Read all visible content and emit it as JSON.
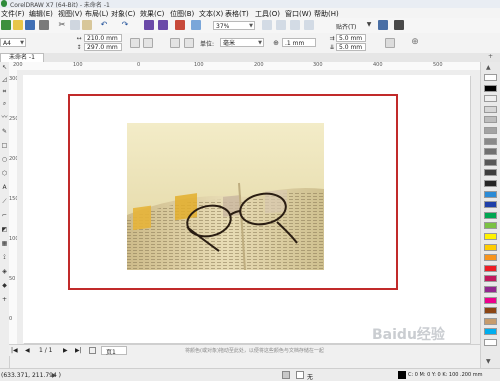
{
  "window": {
    "title": "CorelDRAW X7 (64-Bit) - 未命名 -1"
  },
  "menu": [
    "文件(F)",
    "编辑(E)",
    "视图(V)",
    "布局(L)",
    "对象(C)",
    "效果(C)",
    "位图(B)",
    "文本(X)",
    "表格(T)",
    "工具(O)",
    "窗口(W)",
    "帮助(H)"
  ],
  "standard_bar": {
    "zoom": "37%",
    "snap_label": "贴齐(T)"
  },
  "property_bar": {
    "page_size": "A4",
    "width": "210.0 mm",
    "height": "297.0 mm",
    "units_label": "单位:",
    "units_value": "毫米",
    "nudge": ".1 mm",
    "dup_x": "5.0 mm",
    "dup_y": "5.0 mm"
  },
  "document": {
    "tab_label": "未命名 -1"
  },
  "ruler": {
    "h_labels": [
      "200",
      "100",
      "0",
      "100",
      "200",
      "300",
      "400",
      "500"
    ],
    "v_labels": [
      "300",
      "250",
      "200",
      "150",
      "100",
      "50",
      "0"
    ]
  },
  "page_nav": {
    "counter": "1 / 1",
    "page_tab": "页1",
    "hint": "将颜色(或对象)拖动至此处，以便将这些颜色与文档存储在一起"
  },
  "status": {
    "coords": "(633.371, 211.794 )",
    "fill_label": "无",
    "outline_info": "C: 0 M: 0 Y: 0 K: 100 .200 mm"
  },
  "watermark": "Baidu经验",
  "colors": {
    "frame_red": "#c12a2a",
    "palette": [
      "#ffffff",
      "#000000",
      "#eeeeee",
      "#d6d6d6",
      "#bdbdbd",
      "#a3a3a3",
      "#8a8a8a",
      "#707070",
      "#575757",
      "#3d3d3d",
      "#242424",
      "#2b8bd6",
      "#1e3fa8",
      "#00a651",
      "#7ac143",
      "#fff200",
      "#ffcc00",
      "#f7941d",
      "#ed1c24",
      "#c2185b",
      "#92278f",
      "#ec008c",
      "#8b4513",
      "#c69c6d",
      "#00aeef",
      "#ffffff"
    ]
  },
  "icons": [
    "new-icon",
    "open-icon",
    "save-icon",
    "print-icon",
    "cut-icon",
    "copy-icon",
    "paste-icon",
    "undo-icon",
    "redo-icon",
    "import-icon",
    "export-icon",
    "publish-pdf-icon",
    "options-icon"
  ]
}
